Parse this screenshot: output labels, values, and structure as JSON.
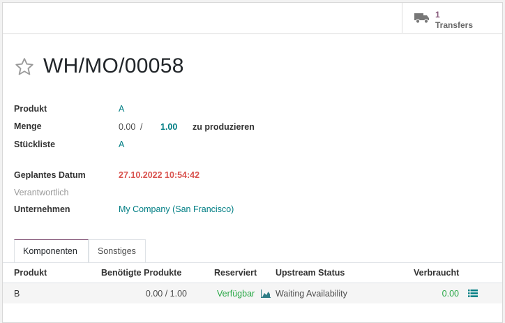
{
  "smart_button": {
    "count": "1",
    "label": "Transfers",
    "icon": "truck-icon"
  },
  "record": {
    "name": "WH/MO/00058",
    "favorite_icon": "star-outline-icon"
  },
  "fields": {
    "product": {
      "label": "Produkt",
      "value": "A"
    },
    "quantity": {
      "label": "Menge",
      "produced": "0.00",
      "separator": "/",
      "to_produce": "1.00",
      "suffix": "zu produzieren"
    },
    "bom": {
      "label": "Stückliste",
      "value": "A"
    },
    "planned_date": {
      "label": "Geplantes Datum",
      "value": "27.10.2022 10:54:42"
    },
    "responsible": {
      "label": "Verantwortlich",
      "value": ""
    },
    "company": {
      "label": "Unternehmen",
      "value": "My Company (San Francisco)"
    }
  },
  "tabs": [
    {
      "label": "Komponenten",
      "active": true
    },
    {
      "label": "Sonstiges",
      "active": false
    }
  ],
  "table": {
    "headers": [
      "Produkt",
      "Benötigte Produkte",
      "Reserviert",
      "Upstream Status",
      "Verbraucht"
    ],
    "rows": [
      {
        "product": "B",
        "required": "0.00 / 1.00",
        "reserved": "Verfügbar",
        "upstream": "Waiting Availability",
        "consumed": "0.00"
      }
    ]
  },
  "colors": {
    "accent": "#875a7b",
    "link": "#017e84",
    "danger": "#d9534f",
    "success": "#28a745"
  }
}
